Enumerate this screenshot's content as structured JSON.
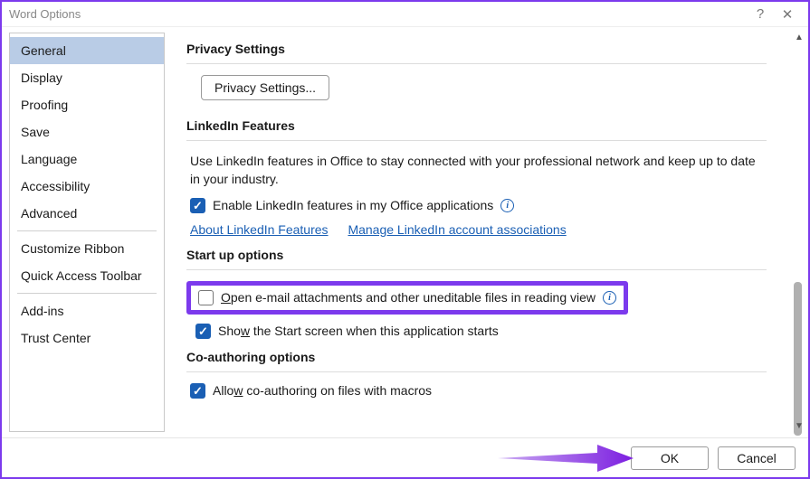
{
  "window": {
    "title": "Word Options"
  },
  "sidebar": {
    "items": [
      {
        "label": "General",
        "selected": true
      },
      {
        "label": "Display"
      },
      {
        "label": "Proofing"
      },
      {
        "label": "Save"
      },
      {
        "label": "Language"
      },
      {
        "label": "Accessibility"
      },
      {
        "label": "Advanced"
      },
      {
        "sep": true
      },
      {
        "label": "Customize Ribbon"
      },
      {
        "label": "Quick Access Toolbar"
      },
      {
        "sep": true
      },
      {
        "label": "Add-ins"
      },
      {
        "label": "Trust Center"
      }
    ]
  },
  "privacy": {
    "heading": "Privacy Settings",
    "button": "Privacy Settings..."
  },
  "linkedin": {
    "heading": "LinkedIn Features",
    "description": "Use LinkedIn features in Office to stay connected with your professional network and keep up to date in your industry.",
    "checkbox_label": "Enable LinkedIn features in my Office applications",
    "checkbox_checked": true,
    "link_about": "About LinkedIn Features",
    "link_manage": "Manage LinkedIn account associations"
  },
  "startup": {
    "heading": "Start up options",
    "open_attachments_label_pre": "O",
    "open_attachments_label_rest": "pen e-mail attachments and other uneditable files in reading view",
    "open_attachments_checked": false,
    "show_start_label_pre": "S",
    "show_start_label_mid": "ho",
    "show_start_label_u": "w",
    "show_start_label_rest": " the Start screen when this application starts",
    "show_start_checked": true
  },
  "coauth": {
    "heading": "Co-authoring options",
    "allow_label_pre": "Allo",
    "allow_label_u": "w",
    "allow_label_rest": " co-authoring on files with macros",
    "allow_checked": true
  },
  "footer": {
    "ok": "OK",
    "cancel": "Cancel"
  },
  "colors": {
    "accent": "#1a5fb4",
    "annotation": "#7c3aed"
  }
}
